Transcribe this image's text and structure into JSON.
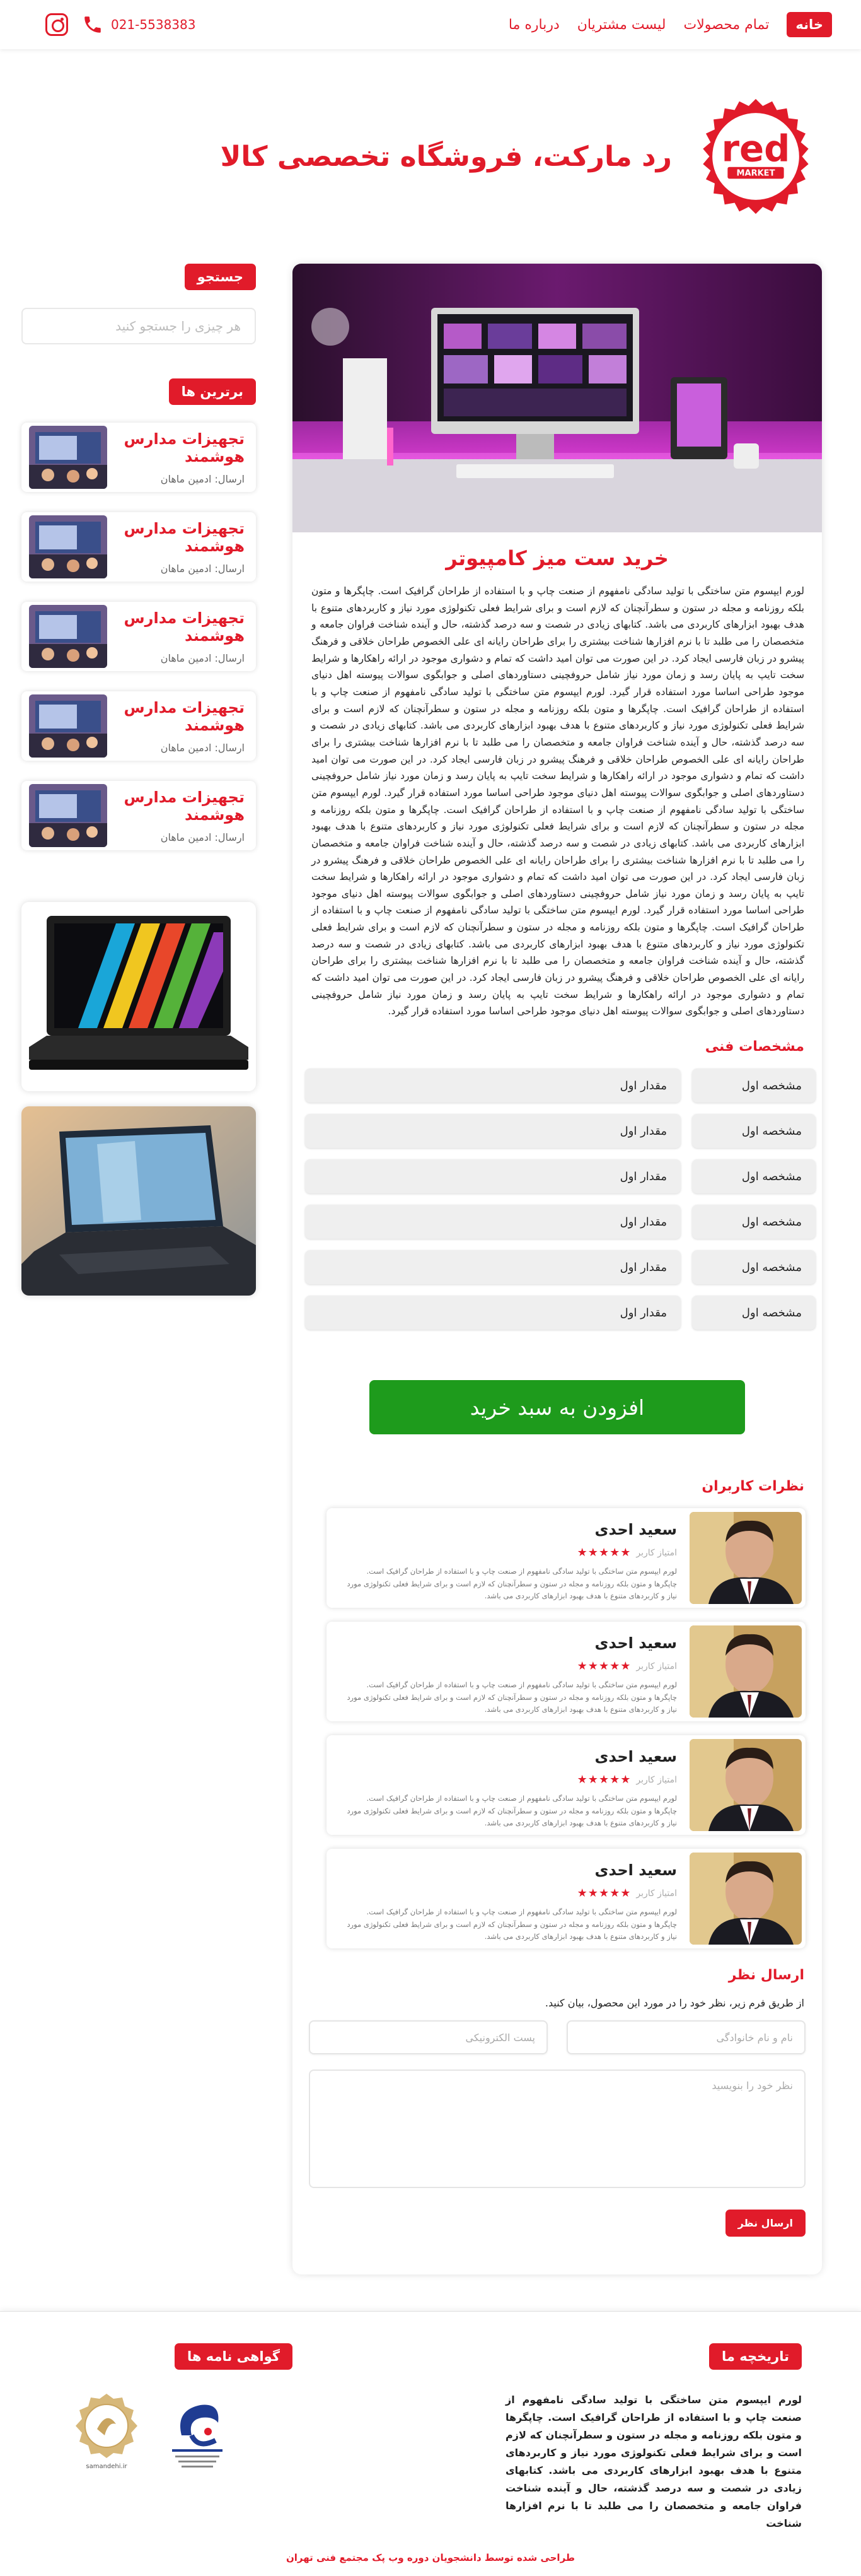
{
  "nav": {
    "home": "خانه",
    "products": "تمام محصولات",
    "customers": "لیست مشتریان",
    "about": "درباره ما",
    "phone": "021-5538383",
    "phone_icon": "phone-icon",
    "instagram_icon": "instagram-icon"
  },
  "hero": {
    "title": "رد مارکت، فروشگاه تخصصی کالا",
    "logo_text": "red",
    "logo_subtext": "MARKET"
  },
  "colors": {
    "brand": "#e11b2a",
    "cart": "#1e9b1c"
  },
  "sidebar": {
    "search_heading": "جستجو",
    "search_placeholder": "هر چیزی را جستجو کنید",
    "top_heading": "برترین ها",
    "posts": [
      {
        "title": "تجهیزات مدارس هوشمند",
        "meta": "ارسال: ادمین ماهان"
      },
      {
        "title": "تجهیزات مدارس هوشمند",
        "meta": "ارسال: ادمین ماهان"
      },
      {
        "title": "تجهیزات مدارس هوشمند",
        "meta": "ارسال: ادمین ماهان"
      },
      {
        "title": "تجهیزات مدارس هوشمند",
        "meta": "ارسال: ادمین ماهان"
      },
      {
        "title": "تجهیزات مدارس هوشمند",
        "meta": "ارسال: ادمین ماهان"
      }
    ]
  },
  "product": {
    "title": "خرید ست میز کامپیوتر",
    "description": "لورم ایپسوم متن ساختگی با تولید سادگی نامفهوم از صنعت چاپ و با استفاده از طراحان گرافیک است. چاپگرها و متون بلکه روزنامه و مجله در ستون و سطرآنچنان که لازم است و برای شرایط فعلی تکنولوژی مورد نیاز و کاربردهای متنوع با هدف بهبود ابزارهای کاربردی می باشد. کتابهای زیادی در شصت و سه درصد گذشته، حال و آینده شناخت فراوان جامعه و متخصصان را می طلبد تا با نرم افزارها شناخت بیشتری را برای طراحان رایانه ای علی الخصوص طراحان خلاقی و فرهنگ پیشرو در زبان فارسی ایجاد کرد. در این صورت می توان امید داشت که تمام و دشواری موجود در ارائه راهکارها و شرایط سخت تایپ به پایان رسد و زمان مورد نیاز شامل حروفچینی دستاوردهای اصلی و جوابگوی سوالات پیوسته اهل دنیای موجود طراحی اساسا مورد استفاده قرار گیرد. لورم ایپسوم متن ساختگی با تولید سادگی نامفهوم از صنعت چاپ و با استفاده از طراحان گرافیک است. چاپگرها و متون بلکه روزنامه و مجله در ستون و سطرآنچنان که لازم است و برای شرایط فعلی تکنولوژی مورد نیاز و کاربردهای متنوع با هدف بهبود ابزارهای کاربردی می باشد. کتابهای زیادی در شصت و سه درصد گذشته، حال و آینده شناخت فراوان جامعه و متخصصان را می طلبد تا با نرم افزارها شناخت بیشتری را برای طراحان رایانه ای علی الخصوص طراحان خلاقی و فرهنگ پیشرو در زبان فارسی ایجاد کرد. در این صورت می توان امید داشت که تمام و دشواری موجود در ارائه راهکارها و شرایط سخت تایپ به پایان رسد و زمان مورد نیاز شامل حروفچینی دستاوردهای اصلی و جوابگوی سوالات پیوسته اهل دنیای موجود طراحی اساسا مورد استفاده قرار گیرد. لورم ایپسوم متن ساختگی با تولید سادگی نامفهوم از صنعت چاپ و با استفاده از طراحان گرافیک است. چاپگرها و متون بلکه روزنامه و مجله در ستون و سطرآنچنان که لازم است و برای شرایط فعلی تکنولوژی مورد نیاز و کاربردهای متنوع با هدف بهبود ابزارهای کاربردی می باشد. کتابهای زیادی در شصت و سه درصد گذشته، حال و آینده شناخت فراوان جامعه و متخصصان را می طلبد تا با نرم افزارها شناخت بیشتری را برای طراحان رایانه ای علی الخصوص طراحان خلاقی و فرهنگ پیشرو در زبان فارسی ایجاد کرد. در این صورت می توان امید داشت که تمام و دشواری موجود در ارائه راهکارها و شرایط سخت تایپ به پایان رسد و زمان مورد نیاز شامل حروفچینی دستاوردهای اصلی و جوابگوی سوالات پیوسته اهل دنیای موجود طراحی اساسا مورد استفاده قرار گیرد. لورم ایپسوم متن ساختگی با تولید سادگی نامفهوم از صنعت چاپ و با استفاده از طراحان گرافیک است. چاپگرها و متون بلکه روزنامه و مجله در ستون و سطرآنچنان که لازم است و برای شرایط فعلی تکنولوژی مورد نیاز و کاربردهای متنوع با هدف بهبود ابزارهای کاربردی می باشد. کتابهای زیادی در شصت و سه درصد گذشته، حال و آینده شناخت فراوان جامعه و متخصصان را می طلبد تا با نرم افزارها شناخت بیشتری را برای طراحان رایانه ای علی الخصوص طراحان خلاقی و فرهنگ پیشرو در زبان فارسی ایجاد کرد. در این صورت می توان امید داشت که تمام و دشواری موجود در ارائه راهکارها و شرایط سخت تایپ به پایان رسد و زمان مورد نیاز شامل حروفچینی دستاوردهای اصلی و جوابگوی سوالات پیوسته اهل دنیای موجود طراحی اساسا مورد استفاده قرار گیرد.",
    "specs_heading": "مشخصات فنی",
    "specs": [
      {
        "key": "مشخصه اول",
        "value": "مقدار اول"
      },
      {
        "key": "مشخصه اول",
        "value": "مقدار اول"
      },
      {
        "key": "مشخصه اول",
        "value": "مقدار اول"
      },
      {
        "key": "مشخصه اول",
        "value": "مقدار اول"
      },
      {
        "key": "مشخصه اول",
        "value": "مقدار اول"
      },
      {
        "key": "مشخصه اول",
        "value": "مقدار اول"
      }
    ],
    "add_to_cart": "افزودن به سبد خرید"
  },
  "comments": {
    "heading": "نظرات کاربران",
    "items": [
      {
        "name": "سعید احدی",
        "rating_label": "امتیاز کاربر",
        "stars": 5,
        "text": "لورم ایپسوم متن ساختگی با تولید سادگی نامفهوم از صنعت چاپ و با استفاده از طراحان گرافیک است. چاپگرها و متون بلکه روزنامه و مجله در ستون و سطرآنچنان که لازم است و برای شرایط فعلی تکنولوژی مورد نیاز و کاربردهای متنوع با هدف بهبود ابزارهای کاربردی می باشد."
      },
      {
        "name": "سعید احدی",
        "rating_label": "امتیاز کاربر",
        "stars": 5,
        "text": "لورم ایپسوم متن ساختگی با تولید سادگی نامفهوم از صنعت چاپ و با استفاده از طراحان گرافیک است. چاپگرها و متون بلکه روزنامه و مجله در ستون و سطرآنچنان که لازم است و برای شرایط فعلی تکنولوژی مورد نیاز و کاربردهای متنوع با هدف بهبود ابزارهای کاربردی می باشد."
      },
      {
        "name": "سعید احدی",
        "rating_label": "امتیاز کاربر",
        "stars": 5,
        "text": "لورم ایپسوم متن ساختگی با تولید سادگی نامفهوم از صنعت چاپ و با استفاده از طراحان گرافیک است. چاپگرها و متون بلکه روزنامه و مجله در ستون و سطرآنچنان که لازم است و برای شرایط فعلی تکنولوژی مورد نیاز و کاربردهای متنوع با هدف بهبود ابزارهای کاربردی می باشد."
      },
      {
        "name": "سعید احدی",
        "rating_label": "امتیاز کاربر",
        "stars": 5,
        "text": "لورم ایپسوم متن ساختگی با تولید سادگی نامفهوم از صنعت چاپ و با استفاده از طراحان گرافیک است. چاپگرها و متون بلکه روزنامه و مجله در ستون و سطرآنچنان که لازم است و برای شرایط فعلی تکنولوژی مورد نیاز و کاربردهای متنوع با هدف بهبود ابزارهای کاربردی می باشد."
      }
    ]
  },
  "review_form": {
    "heading": "ارسال نظر",
    "intro": "از طریق فرم زیر، نظر خود را در مورد این محصول، بیان کنید.",
    "name_placeholder": "نام و نام خانوادگی",
    "email_placeholder": "پست الکترونیکی",
    "message_placeholder": "نظر خود را بنویسید",
    "submit": "ارسال نظر"
  },
  "footer": {
    "history_heading": "تاریخچه ما",
    "history_text": "لورم ایپسوم متن ساختگی با تولید سادگی نامفهوم از صنعت چاپ و با استفاده از طراحان گرافیک است. چاپگرها و متون بلکه روزنامه و مجله در ستون و سطرآنچنان که لازم است و برای شرایط فعلی تکنولوژی مورد نیاز و کاربردهای متنوع با هدف بهبود ابزارهای کاربردی می باشد. کتابهای زیادی در شصت و سه درصد گذشته، حال و آینده شناخت فراوان جامعه و متخصصان را می طلبد تا با نرم افزارها شناخت",
    "certs_heading": "گواهی نامه ها",
    "samandehi_label": "samandehi.ir",
    "copyright": "طراحی شده توسط دانشجویان دوره وب پک مجتمع فنی تهران"
  }
}
